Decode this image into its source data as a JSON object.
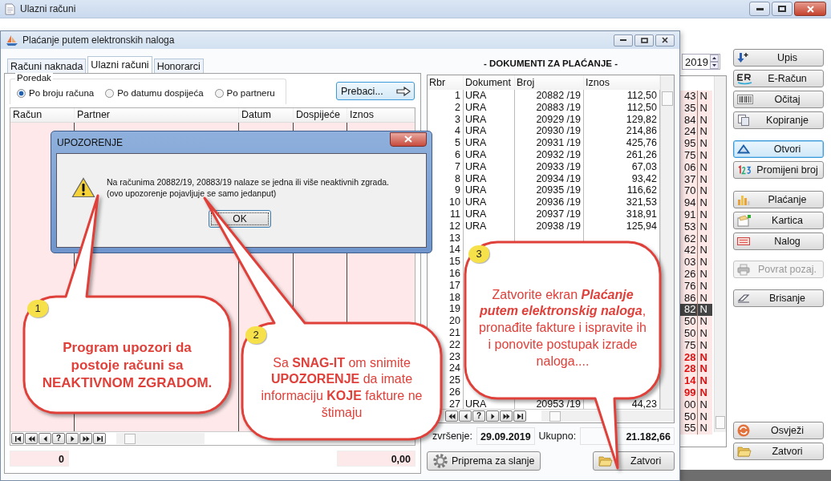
{
  "window": {
    "title": "Ulazni računi"
  },
  "year": "2019",
  "amount_list": {
    "rows": [
      {
        "amount": "43",
        "flag": "N",
        "selected": false,
        "warning": false
      },
      {
        "amount": "35",
        "flag": "N",
        "selected": false,
        "warning": false
      },
      {
        "amount": "84",
        "flag": "N",
        "selected": false,
        "warning": false
      },
      {
        "amount": "24",
        "flag": "N",
        "selected": false,
        "warning": false
      },
      {
        "amount": "95",
        "flag": "N",
        "selected": false,
        "warning": false
      },
      {
        "amount": "75",
        "flag": "N",
        "selected": false,
        "warning": false
      },
      {
        "amount": "06",
        "flag": "N",
        "selected": false,
        "warning": false
      },
      {
        "amount": "37",
        "flag": "N",
        "selected": false,
        "warning": false
      },
      {
        "amount": "70",
        "flag": "N",
        "selected": false,
        "warning": false
      },
      {
        "amount": "94",
        "flag": "N",
        "selected": false,
        "warning": false
      },
      {
        "amount": "91",
        "flag": "N",
        "selected": false,
        "warning": false
      },
      {
        "amount": "53",
        "flag": "N",
        "selected": false,
        "warning": false
      },
      {
        "amount": "62",
        "flag": "N",
        "selected": false,
        "warning": false
      },
      {
        "amount": "42",
        "flag": "N",
        "selected": false,
        "warning": false
      },
      {
        "amount": "03",
        "flag": "N",
        "selected": false,
        "warning": false
      },
      {
        "amount": "26",
        "flag": "N",
        "selected": false,
        "warning": false
      },
      {
        "amount": "76",
        "flag": "N",
        "selected": false,
        "warning": false
      },
      {
        "amount": "86",
        "flag": "N",
        "selected": false,
        "warning": false
      },
      {
        "amount": "82",
        "flag": "N",
        "selected": true,
        "warning": false
      },
      {
        "amount": "50",
        "flag": "N",
        "selected": false,
        "warning": false
      },
      {
        "amount": "50",
        "flag": "N",
        "selected": false,
        "warning": false
      },
      {
        "amount": "75",
        "flag": "N",
        "selected": false,
        "warning": false
      },
      {
        "amount": "28",
        "flag": "N",
        "selected": false,
        "warning": true
      },
      {
        "amount": "28",
        "flag": "N",
        "selected": false,
        "warning": true
      },
      {
        "amount": "14",
        "flag": "N",
        "selected": false,
        "warning": true
      },
      {
        "amount": "99",
        "flag": "N",
        "selected": false,
        "warning": true
      },
      {
        "amount": "00",
        "flag": "N",
        "selected": false,
        "warning": false
      },
      {
        "amount": "50",
        "flag": "N",
        "selected": false,
        "warning": false
      },
      {
        "amount": "55",
        "flag": "N",
        "selected": false,
        "warning": false
      }
    ]
  },
  "side_buttons": [
    {
      "label": "Upis",
      "kind": "download",
      "disabled": false,
      "focused": false
    },
    {
      "label": "E-Račun",
      "kind": "erac",
      "disabled": false,
      "focused": false
    },
    {
      "label": "Očitaj",
      "kind": "barcode",
      "disabled": false,
      "focused": false
    },
    {
      "label": "Kopiranje",
      "kind": "copy",
      "disabled": false,
      "focused": false
    },
    {
      "label": "Otvori",
      "kind": "triangle",
      "disabled": false,
      "focused": true
    },
    {
      "label": "Promijeni broj",
      "kind": "numbers",
      "disabled": false,
      "focused": false
    },
    {
      "label": "Plaćanje",
      "kind": "chart",
      "disabled": false,
      "focused": false
    },
    {
      "label": "Kartica",
      "kind": "card",
      "disabled": false,
      "focused": false
    },
    {
      "label": "Nalog",
      "kind": "form",
      "disabled": false,
      "focused": false
    },
    {
      "label": "Povrat pozaj.",
      "kind": "printer",
      "disabled": true,
      "focused": false
    },
    {
      "label": "Brisanje",
      "kind": "eraser",
      "disabled": false,
      "focused": false
    },
    {
      "label": "Osvježi",
      "kind": "refresh",
      "disabled": false,
      "focused": false
    },
    {
      "label": "Zatvori",
      "kind": "folder",
      "disabled": false,
      "focused": false
    }
  ],
  "payment_window": {
    "title": "Plaćanje putem elektronskih naloga",
    "tabs": [
      {
        "label": "Računi naknada",
        "selected": false
      },
      {
        "label": "Ulazni računi",
        "selected": true
      },
      {
        "label": "Honorarci",
        "selected": false
      }
    ],
    "order_group": {
      "title": "Poredak",
      "options": [
        {
          "label": "Po broju računa",
          "selected": true
        },
        {
          "label": "Po datumu dospijeća",
          "selected": false
        },
        {
          "label": "Po partneru",
          "selected": false
        }
      ]
    },
    "transfer_button": "Prebaci...",
    "invoice_table": {
      "columns": [
        "Račun",
        "Partner",
        "Datum",
        "Dospijeće",
        "Iznos"
      ]
    },
    "invoice_nav": [
      {
        "kind": "first"
      },
      {
        "kind": "prev-page"
      },
      {
        "kind": "prev"
      },
      {
        "kind": "help",
        "label": "?"
      },
      {
        "kind": "next"
      },
      {
        "kind": "next-page"
      },
      {
        "kind": "last"
      }
    ],
    "count_total": "0",
    "amount_total": "0,00",
    "documents": {
      "title": "- DOKUMENTI ZA PLAĆANJE -",
      "columns": [
        "Rbr",
        "Dokument",
        "Broj",
        "Iznos"
      ],
      "rows": [
        {
          "rbr": "1",
          "document": "URA",
          "number": "20882 /19",
          "amount": "112,50"
        },
        {
          "rbr": "2",
          "document": "URA",
          "number": "20883 /19",
          "amount": "112,50"
        },
        {
          "rbr": "3",
          "document": "URA",
          "number": "20929 /19",
          "amount": "129,82"
        },
        {
          "rbr": "4",
          "document": "URA",
          "number": "20930 /19",
          "amount": "214,86"
        },
        {
          "rbr": "5",
          "document": "URA",
          "number": "20931 /19",
          "amount": "425,76"
        },
        {
          "rbr": "6",
          "document": "URA",
          "number": "20932 /19",
          "amount": "261,26"
        },
        {
          "rbr": "7",
          "document": "URA",
          "number": "20933 /19",
          "amount": "67,03"
        },
        {
          "rbr": "8",
          "document": "URA",
          "number": "20934 /19",
          "amount": "93,42"
        },
        {
          "rbr": "9",
          "document": "URA",
          "number": "20935 /19",
          "amount": "116,62"
        },
        {
          "rbr": "10",
          "document": "URA",
          "number": "20936 /19",
          "amount": "321,53"
        },
        {
          "rbr": "11",
          "document": "URA",
          "number": "20937 /19",
          "amount": "318,91"
        },
        {
          "rbr": "12",
          "document": "URA",
          "number": "20938 /19",
          "amount": "125,94"
        },
        {
          "rbr": "13"
        },
        {
          "rbr": "14"
        },
        {
          "rbr": "15"
        },
        {
          "rbr": "16"
        },
        {
          "rbr": "17"
        },
        {
          "rbr": "18"
        },
        {
          "rbr": "19"
        },
        {
          "rbr": "20"
        },
        {
          "rbr": "21"
        },
        {
          "rbr": "22"
        },
        {
          "rbr": "23"
        },
        {
          "rbr": "24"
        },
        {
          "rbr": "25"
        },
        {
          "rbr": "26"
        },
        {
          "rbr": "27",
          "document": "URA",
          "number": "20953 /19",
          "amount": "44,23"
        }
      ]
    },
    "documents_nav": [
      {
        "kind": "prev-page"
      },
      {
        "kind": "prev"
      },
      {
        "kind": "help",
        "label": "?"
      },
      {
        "kind": "next"
      },
      {
        "kind": "next-page"
      },
      {
        "kind": "last"
      }
    ],
    "execution_label": "zvršenje:",
    "execution_date": "29.09.2019",
    "total_label": "Ukupno:",
    "total": "21.182,66",
    "prepare_button": "Priprema za slanje",
    "close_button": "Zatvori"
  },
  "dialog": {
    "title": "UPOZORENJE",
    "message": "Na računima 20882/19, 20883/19 nalaze se jedna ili više neaktivnih zgrada.",
    "note": "(ovo upozorenje pojavljuje se samo jedanput)",
    "button": "OK"
  },
  "callouts": [
    {
      "number": "1",
      "text": "Program upozori da postoje računi sa NEAKTIVNOM ZGRADOM.",
      "bold": true
    },
    {
      "number": "2",
      "text": "Sa **SNAG-IT** om snimite **UPOZORENJE** da imate informaciju **KOJE** fakture ne štimaju",
      "bold": false
    },
    {
      "number": "3",
      "text": "Zatvorite ekran *Plaćanje putem elektronskig naloga*, pronađite fakture i ispravite ih i ponovite postupak izrade naloga....",
      "bold": false
    }
  ]
}
